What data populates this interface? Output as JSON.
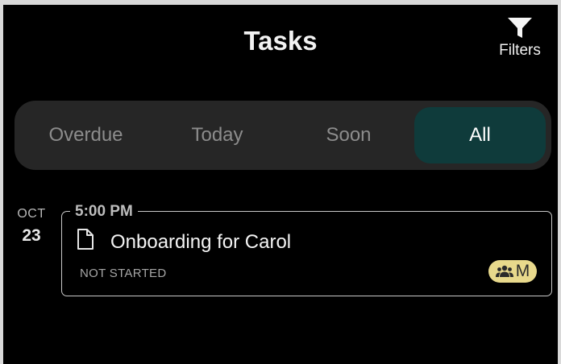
{
  "header": {
    "title": "Tasks",
    "filters_label": "Filters",
    "filters_icon": "funnel-icon"
  },
  "tabs": [
    {
      "label": "Overdue",
      "active": false
    },
    {
      "label": "Today",
      "active": false
    },
    {
      "label": "Soon",
      "active": false
    },
    {
      "label": "All",
      "active": true
    }
  ],
  "colors": {
    "background": "#000000",
    "active_tab": "#0f3b3b",
    "segment_bg": "#262626",
    "badge": "#e8d98c"
  },
  "tasks": [
    {
      "date_month": "OCT",
      "date_day": "23",
      "time": "5:00 PM",
      "icon": "document-icon",
      "title": "Onboarding for Carol",
      "status": "NOT STARTED",
      "assignee_icon": "group-icon",
      "assignee_initial": "M"
    }
  ]
}
